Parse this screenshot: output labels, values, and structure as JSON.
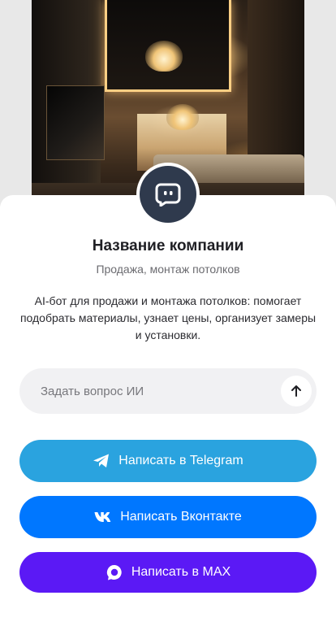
{
  "company": {
    "name": "Название компании",
    "subtitle": "Продажа, монтаж потолков",
    "description": "AI-бот для продажи и монтажа потолков: помогает подобрать материалы, узнает цены, организует замеры и установки."
  },
  "ask": {
    "placeholder": "Задать вопрос ИИ"
  },
  "buttons": {
    "telegram": {
      "label": "Написать в Telegram",
      "color": "#2aa3df"
    },
    "vk": {
      "label": "Написать Вконтакте",
      "color": "#0077ff"
    },
    "max": {
      "label": "Написать в MAX",
      "color": "#5b19f5"
    }
  },
  "avatar": {
    "icon": "chat-bot-icon",
    "color": "#2f3a4d"
  },
  "icons": {
    "send": "arrow-up-icon",
    "telegram": "telegram-icon",
    "vk": "vk-icon",
    "max": "max-icon"
  }
}
